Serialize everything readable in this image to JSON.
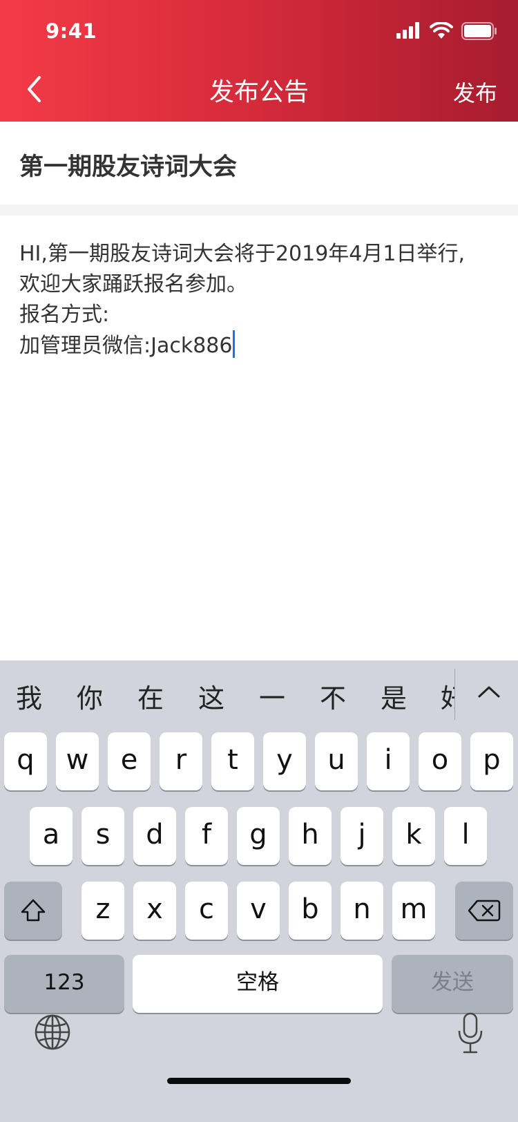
{
  "status_bar": {
    "time": "9:41",
    "icons": [
      "signal-icon",
      "wifi-icon",
      "battery-icon"
    ]
  },
  "nav": {
    "back_icon": "chevron-left-icon",
    "title": "发布公告",
    "action": "发布"
  },
  "editor": {
    "title": "第一期股友诗词大会",
    "lines": [
      "HI,第一期股友诗词大会将于2019年4月1日举行,",
      "欢迎大家踊跃报名参加。",
      "报名方式:",
      "加管理员微信:Jack886"
    ]
  },
  "keyboard": {
    "candidates": [
      "我",
      "你",
      "在",
      "这",
      "一",
      "不",
      "是",
      "好"
    ],
    "row1": [
      "q",
      "w",
      "e",
      "r",
      "t",
      "y",
      "u",
      "i",
      "o",
      "p"
    ],
    "row2": [
      "a",
      "s",
      "d",
      "f",
      "g",
      "h",
      "j",
      "k",
      "l"
    ],
    "row3": [
      "z",
      "x",
      "c",
      "v",
      "b",
      "n",
      "m"
    ],
    "numbers_label": "123",
    "space_label": "空格",
    "send_label": "发送"
  },
  "colors": {
    "header_start": "#f43a47",
    "header_end": "#a71c2f",
    "caret": "#1e6ff0",
    "keyboard_bg": "#d1d4db"
  }
}
